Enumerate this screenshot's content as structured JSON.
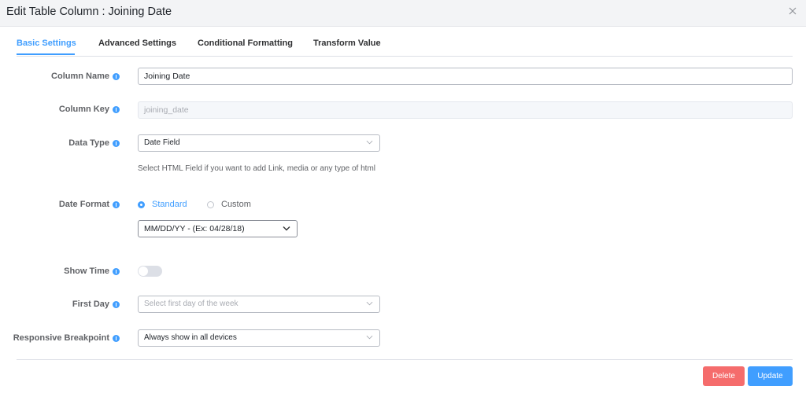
{
  "dialog": {
    "title": "Edit Table Column : Joining Date"
  },
  "tabs": [
    {
      "label": "Basic Settings",
      "active": true
    },
    {
      "label": "Advanced Settings"
    },
    {
      "label": "Conditional Formatting"
    },
    {
      "label": "Transform Value"
    }
  ],
  "form": {
    "column_name": {
      "label": "Column Name",
      "value": "Joining Date"
    },
    "column_key": {
      "label": "Column Key",
      "placeholder": "joining_date"
    },
    "data_type": {
      "label": "Data Type",
      "value": "Date Field",
      "help": "Select HTML Field if you want to add Link, media or any type of html"
    },
    "date_format": {
      "label": "Date Format",
      "options": [
        "Standard",
        "Custom"
      ],
      "selected": "Standard",
      "format_value": "MM/DD/YY - (Ex: 04/28/18)"
    },
    "show_time": {
      "label": "Show Time",
      "enabled": false
    },
    "first_day": {
      "label": "First Day",
      "placeholder": "Select first day of the week"
    },
    "responsive": {
      "label": "Responsive Breakpoint",
      "value": "Always show in all devices"
    }
  },
  "buttons": {
    "delete": "Delete",
    "update": "Update"
  },
  "colors": {
    "accent": "#409eff",
    "danger": "#f56c6c"
  },
  "icons": {
    "close": "close-icon",
    "info": "info-icon",
    "chevron": "chevron-down-icon"
  }
}
